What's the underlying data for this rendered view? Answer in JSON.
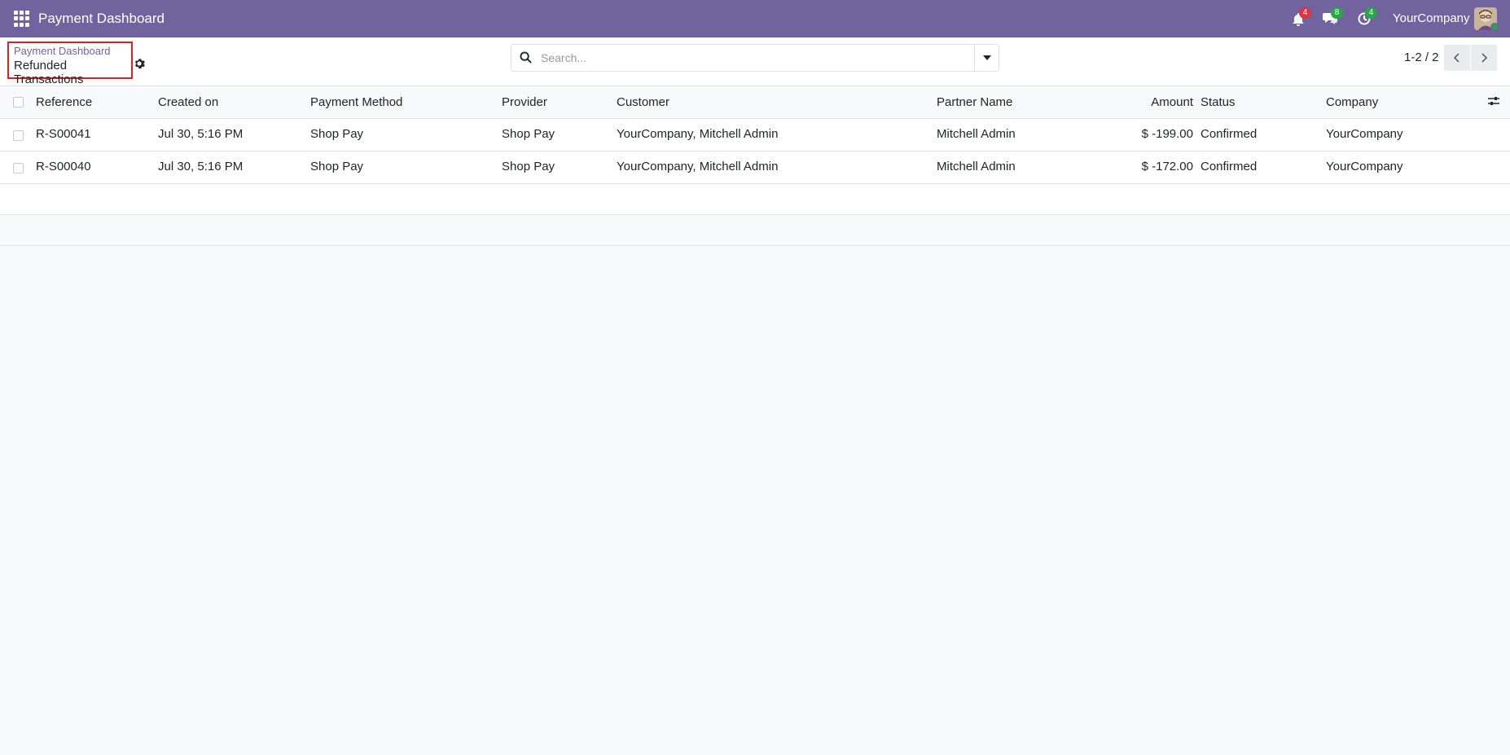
{
  "navbar": {
    "brand": "Payment Dashboard",
    "activity_badge": "4",
    "messages_badge": "8",
    "timer_badge": "4",
    "company": "YourCompany",
    "badge_colors": {
      "activity": "#dc3545",
      "messages": "#28a745",
      "timer": "#28a745"
    }
  },
  "breadcrumb": {
    "parent": "Payment Dashboard",
    "current": "Refunded Transactions"
  },
  "search": {
    "placeholder": "Search..."
  },
  "pager": {
    "value": "1-2 / 2"
  },
  "table": {
    "columns": [
      "Reference",
      "Created on",
      "Payment Method",
      "Provider",
      "Customer",
      "Partner Name",
      "Amount",
      "Status",
      "Company"
    ],
    "rows": [
      {
        "reference": "R-S00041",
        "created_on": "Jul 30, 5:16 PM",
        "payment_method": "Shop Pay",
        "provider": "Shop Pay",
        "customer": "YourCompany, Mitchell Admin",
        "partner_name": "Mitchell Admin",
        "amount": "$ -199.00",
        "status": "Confirmed",
        "company": "YourCompany"
      },
      {
        "reference": "R-S00040",
        "created_on": "Jul 30, 5:16 PM",
        "payment_method": "Shop Pay",
        "provider": "Shop Pay",
        "customer": "YourCompany, Mitchell Admin",
        "partner_name": "Mitchell Admin",
        "amount": "$ -172.00",
        "status": "Confirmed",
        "company": "YourCompany"
      }
    ]
  },
  "colors": {
    "navbar": "#71639e",
    "highlight_border": "#e02020"
  }
}
